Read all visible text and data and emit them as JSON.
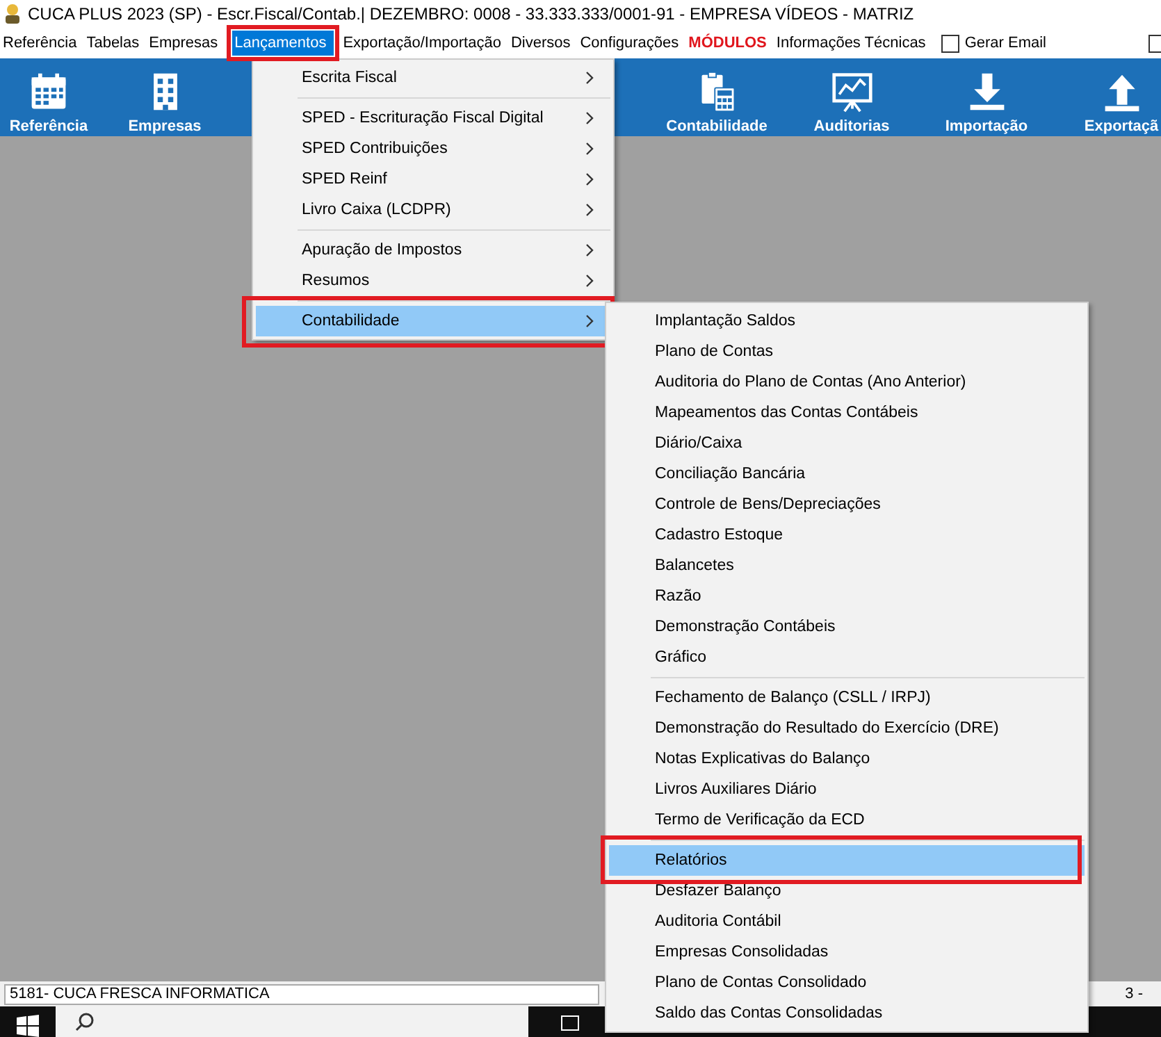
{
  "window": {
    "title": "CUCA PLUS 2023 (SP) - Escr.Fiscal/Contab.| DEZEMBRO: 0008 - 33.333.333/0001-91 - EMPRESA VÍDEOS - MATRIZ"
  },
  "menu_bar": {
    "items": [
      {
        "label": "Referência",
        "kind": "normal",
        "selected": false
      },
      {
        "label": "Tabelas",
        "kind": "normal",
        "selected": false
      },
      {
        "label": "Empresas",
        "kind": "normal",
        "selected": false
      },
      {
        "label": "Lançamentos",
        "kind": "normal",
        "selected": true
      },
      {
        "label": "Exportação/Importação",
        "kind": "normal",
        "selected": false
      },
      {
        "label": "Diversos",
        "kind": "normal",
        "selected": false
      },
      {
        "label": "Configurações",
        "kind": "normal",
        "selected": false
      },
      {
        "label": "MÓDULOS",
        "kind": "modules",
        "selected": false
      },
      {
        "label": "Informações Técnicas",
        "kind": "normal",
        "selected": false
      }
    ],
    "checkbox": {
      "label": "Gerar Email",
      "checked": false
    },
    "edge_checkbox": {
      "checked": false
    }
  },
  "toolbar": {
    "left": [
      {
        "label": "Referência"
      },
      {
        "label": "Empresas"
      }
    ],
    "right": [
      {
        "label": "Contabilidade"
      },
      {
        "label": "Auditorias"
      },
      {
        "label": "Importação"
      },
      {
        "label": "Exportaçã"
      }
    ]
  },
  "lancamentos_menu": {
    "groups": [
      [
        {
          "label": "Escrita Fiscal",
          "selected": false,
          "has_submenu": true
        }
      ],
      [
        {
          "label": "SPED - Escrituração Fiscal Digital",
          "selected": false,
          "has_submenu": true
        },
        {
          "label": "SPED Contribuições",
          "selected": false,
          "has_submenu": true
        },
        {
          "label": "SPED Reinf",
          "selected": false,
          "has_submenu": true
        },
        {
          "label": "Livro Caixa (LCDPR)",
          "selected": false,
          "has_submenu": true
        }
      ],
      [
        {
          "label": "Apuração de Impostos",
          "selected": false,
          "has_submenu": true
        },
        {
          "label": "Resumos",
          "selected": false,
          "has_submenu": true
        }
      ],
      [
        {
          "label": "Contabilidade",
          "selected": true,
          "has_submenu": true
        }
      ]
    ]
  },
  "contabilidade_menu": {
    "groups": [
      [
        {
          "label": "Implantação Saldos",
          "selected": false,
          "has_submenu": false
        },
        {
          "label": "Plano de Contas",
          "selected": false,
          "has_submenu": false
        },
        {
          "label": "Auditoria do Plano de Contas (Ano Anterior)",
          "selected": false,
          "has_submenu": false
        },
        {
          "label": "Mapeamentos das Contas Contábeis",
          "selected": false,
          "has_submenu": false
        },
        {
          "label": "Diário/Caixa",
          "selected": false,
          "has_submenu": false
        },
        {
          "label": "Conciliação Bancária",
          "selected": false,
          "has_submenu": false
        },
        {
          "label": "Controle de Bens/Depreciações",
          "selected": false,
          "has_submenu": false
        },
        {
          "label": "Cadastro Estoque",
          "selected": false,
          "has_submenu": false
        },
        {
          "label": "Balancetes",
          "selected": false,
          "has_submenu": false
        },
        {
          "label": "Razão",
          "selected": false,
          "has_submenu": false
        },
        {
          "label": "Demonstração Contábeis",
          "selected": false,
          "has_submenu": false
        },
        {
          "label": "Gráfico",
          "selected": false,
          "has_submenu": false
        }
      ],
      [
        {
          "label": "Fechamento de Balanço (CSLL / IRPJ)",
          "selected": false,
          "has_submenu": false
        },
        {
          "label": "Demonstração do Resultado do Exercício (DRE)",
          "selected": false,
          "has_submenu": false
        },
        {
          "label": "Notas Explicativas do Balanço",
          "selected": false,
          "has_submenu": false
        },
        {
          "label": "Livros Auxiliares Diário",
          "selected": false,
          "has_submenu": false
        },
        {
          "label": "Termo de Verificação da ECD",
          "selected": false,
          "has_submenu": false
        }
      ],
      [
        {
          "label": "Relatórios",
          "selected": true,
          "has_submenu": false
        },
        {
          "label": "Desfazer Balanço",
          "selected": false,
          "has_submenu": false
        },
        {
          "label": "Auditoria Contábil",
          "selected": false,
          "has_submenu": false
        },
        {
          "label": "Empresas Consolidadas",
          "selected": false,
          "has_submenu": false
        },
        {
          "label": "Plano de Contas Consolidado",
          "selected": false,
          "has_submenu": false
        },
        {
          "label": "Saldo das Contas Consolidadas",
          "selected": false,
          "has_submenu": false
        }
      ]
    ]
  },
  "status_bar": {
    "left": "5181- CUCA FRESCA INFORMATICA",
    "right": "3 -"
  }
}
